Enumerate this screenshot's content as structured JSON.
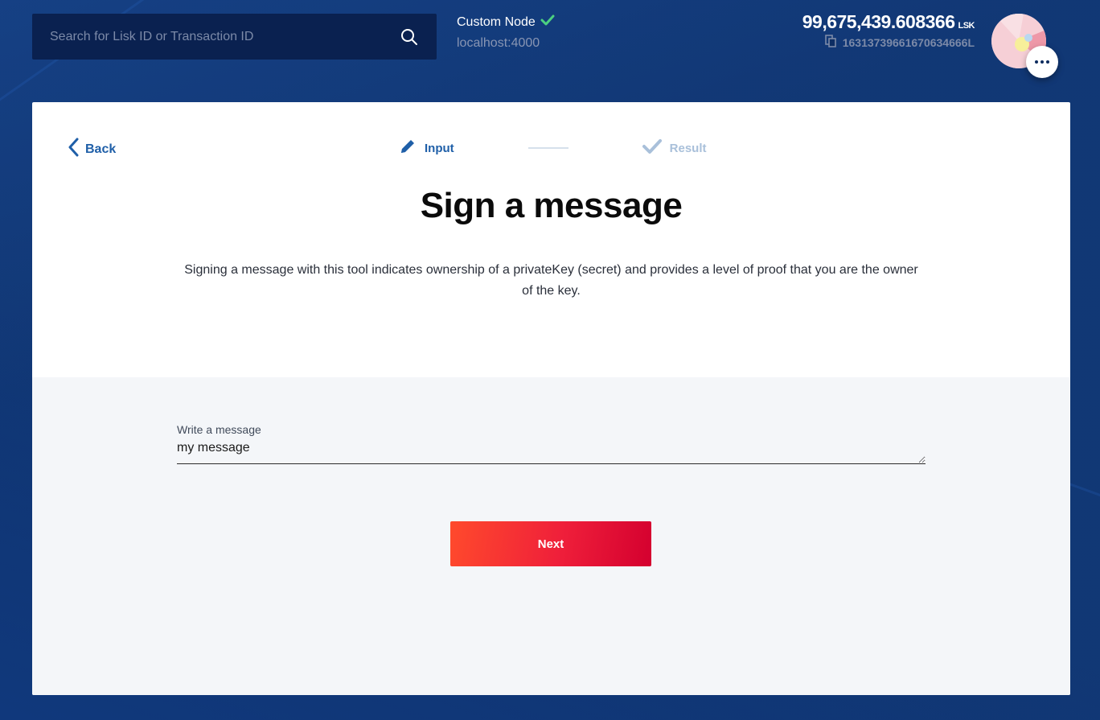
{
  "search": {
    "placeholder": "Search for Lisk ID or Transaction ID",
    "icon": "search-icon"
  },
  "node": {
    "name": "Custom Node",
    "url": "localhost:4000",
    "status_icon": "check-icon",
    "status_color": "#4cd080"
  },
  "account": {
    "balance": "99,675,439.608366",
    "unit": "LSK",
    "address": "16313739661670634666L",
    "copy_icon": "copy-icon"
  },
  "menu": {
    "more_icon": "more-dots-icon"
  },
  "back": {
    "label": "Back",
    "icon": "chevron-left-icon"
  },
  "steps": [
    {
      "label": "Input",
      "icon": "pencil-icon",
      "state": "active"
    },
    {
      "label": "Result",
      "icon": "check-icon",
      "state": "inactive"
    }
  ],
  "page": {
    "title": "Sign a message",
    "description": "Signing a message with this tool indicates ownership of a privateKey (secret) and provides a level of proof that you are the owner of the key."
  },
  "form": {
    "message_label": "Write a message",
    "message_value": "my message",
    "next_label": "Next"
  },
  "colors": {
    "accent": "#1f5fa8",
    "primary_button_start": "#ff4a2c",
    "primary_button_end": "#d4002f",
    "background": "#0c2b5e"
  }
}
